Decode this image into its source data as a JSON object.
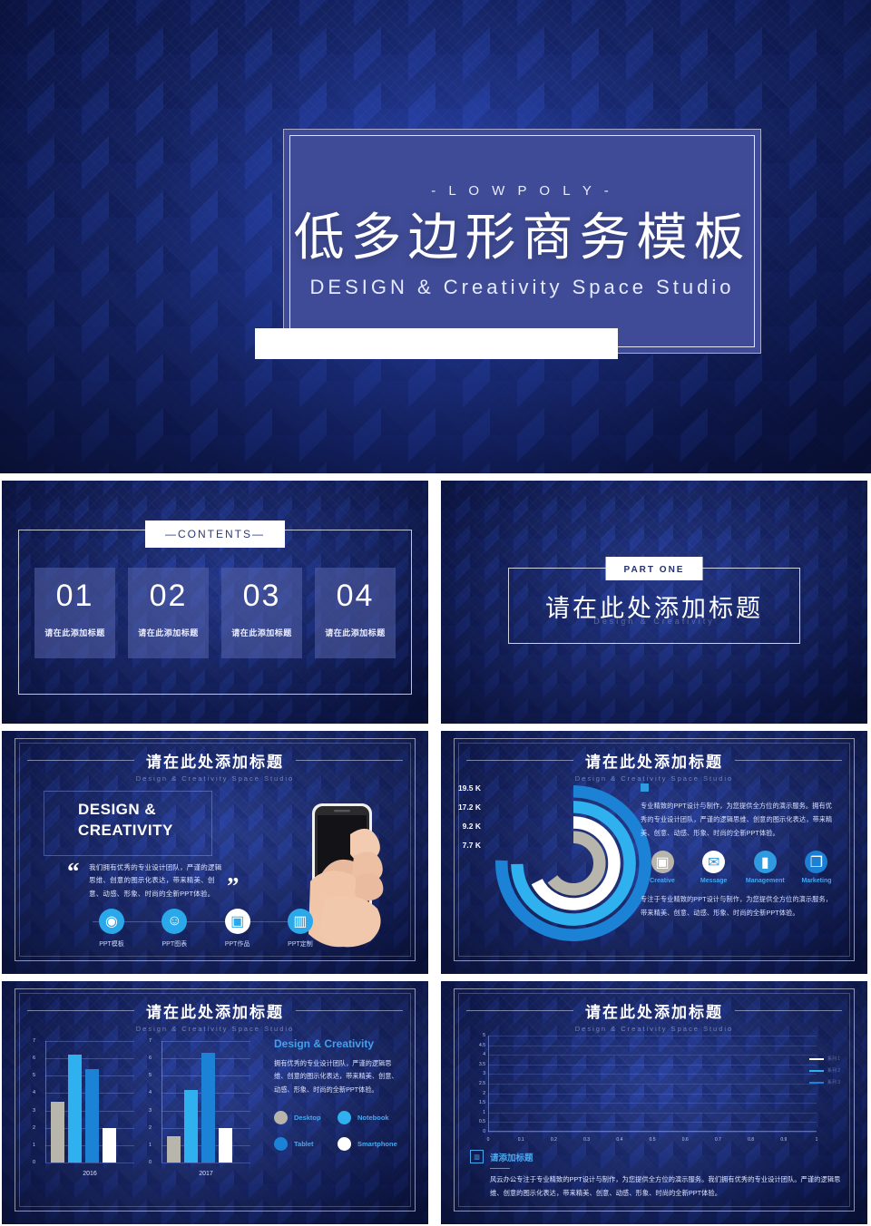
{
  "cover": {
    "eyebrow": "-  L O W   P O L Y  -",
    "title": "低多边形商务模板",
    "subtitle": "DESIGN & Creativity Space Studio",
    "bar_text": ""
  },
  "contents": {
    "chip": "—CONTENTS—",
    "cards": [
      {
        "num": "01",
        "label": "请在此添加标题"
      },
      {
        "num": "02",
        "label": "请在此添加标题"
      },
      {
        "num": "03",
        "label": "请在此添加标题"
      },
      {
        "num": "04",
        "label": "请在此添加标题"
      }
    ]
  },
  "part_one": {
    "chip": "PART ONE",
    "title": "请在此处添加标题",
    "subtitle": "Design & Creativity"
  },
  "header": {
    "title": "请在此处添加标题",
    "subtitle": "Design & Creativity Space Studio"
  },
  "slide_phone": {
    "headline_line1": "DESIGN &",
    "headline_line2": "CREATIVITY",
    "quote_open": "“",
    "quote_close": "”",
    "paragraph": "我们拥有优秀的专业设计团队，严谨的逻辑思维、创意的图示化表达，带来精美、创意、动感、形象、时尚的全新PPT体验。",
    "icons": [
      {
        "icon": "palette-icon",
        "label": "PPT模板",
        "glyph": "◉"
      },
      {
        "icon": "smiley-icon",
        "label": "PPT图表",
        "glyph": "☺"
      },
      {
        "icon": "image-icon",
        "label": "PPT作品",
        "glyph": "▣"
      },
      {
        "icon": "book-icon",
        "label": "PPT定制",
        "glyph": "▥"
      }
    ]
  },
  "slide_donut": {
    "paragraph_top": "专业精致的PPT设计与制作，为您提供全方位的演示服务。拥有优秀的专业设计团队，严谨的逻辑思维、创意的图示化表达，带来精美、创意、动感、形象、时尚的全新PPT体验。",
    "paragraph_bottom": "专注于专业精致的PPT设计与制作，为您提供全方位的演示服务，带来精美、创意、动感、形象、时尚的全新PPT体验。",
    "icons": [
      {
        "icon": "camera-icon",
        "label": "Creative",
        "glyph": "▣",
        "color": "#b8b5ad"
      },
      {
        "icon": "envelope-icon",
        "label": "Message",
        "glyph": "✉",
        "color": "#ffffff"
      },
      {
        "icon": "mouse-icon",
        "label": "Management",
        "glyph": "▮",
        "color": "#2f9ae0"
      },
      {
        "icon": "copy-icon",
        "label": "Marketing",
        "glyph": "❐",
        "color": "#1b7fd4"
      }
    ]
  },
  "slide_bar": {
    "right_title": "Design & Creativity",
    "right_paragraph": "拥有优秀的专业设计团队，严谨的逻辑思维、创意的图示化表达，带来精美、创意、动感、形象、时尚的全新PPT体验。",
    "legend": [
      {
        "label": "Desktop",
        "color": "#b8b5ad"
      },
      {
        "label": "Notebook",
        "color": "#2fb0ef"
      },
      {
        "label": "Tablet",
        "color": "#1b82d6"
      },
      {
        "label": "Smartphone",
        "color": "#ffffff"
      }
    ]
  },
  "slide_line": {
    "bottom_title": "请添加标题",
    "bottom_icon": "chart-settings-icon",
    "bottom_paragraph": "风云办公专注于专业精致的PPT设计与制作，为您提供全方位的演示服务。我们拥有优秀的专业设计团队。严谨的逻辑思维、创意的图示化表达，带来精美、创意、动感、形象、时尚的全新PPT体验。",
    "legend": [
      {
        "label": "系列 1",
        "color": "#ffffff"
      },
      {
        "label": "系列 2",
        "color": "#2fb0ef"
      },
      {
        "label": "系列 3",
        "color": "#1b82d6"
      }
    ]
  },
  "colors": {
    "accent": "#2fa9ee",
    "deep_blue": "#1b2450",
    "cover_panel": "#3f4b96",
    "gray": "#b8b5ad"
  },
  "chart_data": [
    {
      "type": "pie",
      "title": "请在此处添加标题",
      "subtitle": "Design & Creativity Space Studio",
      "labels": [
        "19.5 K",
        "17.2 K",
        "9.2 K",
        "7.7 K"
      ],
      "values": [
        19.5,
        17.2,
        9.2,
        7.7
      ],
      "unit": "K",
      "colors": [
        "#1b82d6",
        "#2fb0ef",
        "#ffffff",
        "#b8b5ad"
      ],
      "legend": "left-labels",
      "note": "concentric progress-ring donut, 4 rings outer→inner"
    },
    {
      "type": "bar",
      "title": "请在此处添加标题",
      "subtitle": "Design & Creativity Space Studio",
      "categories": [
        "2016",
        "2017"
      ],
      "series": [
        {
          "name": "Desktop",
          "color": "#b8b5ad",
          "values": [
            3.5,
            1.5
          ]
        },
        {
          "name": "Notebook",
          "color": "#2fb0ef",
          "values": [
            6.2,
            4.2
          ]
        },
        {
          "name": "Tablet",
          "color": "#1b82d6",
          "values": [
            5.4,
            6.3
          ]
        },
        {
          "name": "Smartphone",
          "color": "#ffffff",
          "values": [
            2.0,
            2.0
          ]
        }
      ],
      "yticks": [
        "0",
        "1",
        "2",
        "3",
        "4",
        "5",
        "6",
        "7"
      ],
      "ylim": [
        0,
        7
      ],
      "xlabel": "",
      "ylabel": "",
      "grid": true,
      "legend": "right"
    },
    {
      "type": "line",
      "title": "请在此处添加标题",
      "subtitle": "Design & Creativity Space Studio",
      "x": [
        0,
        0.1,
        0.2,
        0.3,
        0.4,
        0.5,
        0.6,
        0.7,
        0.8,
        0.9,
        1
      ],
      "xticks": [
        "0",
        "0.1",
        "0.2",
        "0.3",
        "0.4",
        "0.5",
        "0.6",
        "0.7",
        "0.8",
        "0.9",
        "1"
      ],
      "yticks": [
        "0",
        "0.5",
        "1",
        "1.5",
        "2",
        "2.5",
        "3",
        "3.5",
        "4",
        "4.5",
        "5"
      ],
      "ylim": [
        0,
        5
      ],
      "xlim": [
        0,
        1
      ],
      "series": [
        {
          "name": "系列 1",
          "color": "#ffffff",
          "values": []
        },
        {
          "name": "系列 2",
          "color": "#2fb0ef",
          "values": []
        },
        {
          "name": "系列 3",
          "color": "#1b82d6",
          "values": []
        }
      ],
      "grid": true,
      "legend": "right",
      "note": "empty placeholder chart – gridlines only, no plotted data"
    }
  ]
}
